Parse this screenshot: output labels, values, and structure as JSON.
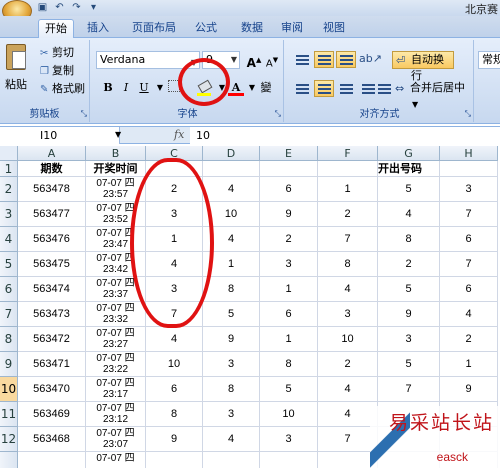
{
  "app": {
    "title": "北京赛"
  },
  "quick_access": {
    "save_icon": "save-icon",
    "undo_icon": "undo-icon",
    "redo_icon": "redo-icon"
  },
  "tabs": [
    {
      "label": "开始",
      "active": true
    },
    {
      "label": "插入"
    },
    {
      "label": "页面布局"
    },
    {
      "label": "公式"
    },
    {
      "label": "数据"
    },
    {
      "label": "审阅"
    },
    {
      "label": "视图"
    }
  ],
  "clipboard": {
    "paste_label": "粘贴",
    "cut_label": "剪切",
    "copy_label": "复制",
    "format_painter_label": "格式刷",
    "group_label": "剪贴板"
  },
  "font": {
    "font_name": "Verdana",
    "font_size": "9",
    "grow_label": "A",
    "shrink_label": "A",
    "bold_label": "B",
    "italic_label": "I",
    "underline_label": "U",
    "font_color_label": "A",
    "phonetic_label": "變",
    "group_label": "字体",
    "fill_color": "#ffff00",
    "font_color": "#ff0000"
  },
  "alignment": {
    "wrap_label": "自动换行",
    "merge_label": "合并后居中",
    "group_label": "对齐方式"
  },
  "number": {
    "format_label": "常规"
  },
  "formula_bar": {
    "name_box": "I10",
    "fx_label": "fx",
    "value": "10"
  },
  "sheet": {
    "columns": [
      "A",
      "B",
      "C",
      "D",
      "E",
      "F",
      "G",
      "H"
    ],
    "header_row": {
      "row_label": "1",
      "A": "期数",
      "B": "开奖时间",
      "draw_numbers_label": "开出号码"
    },
    "rows": [
      {
        "row_label": "2",
        "period": "563478",
        "date": "07-07 四",
        "time": "23:57",
        "values": [
          "2",
          "4",
          "6",
          "1",
          "5",
          "3"
        ]
      },
      {
        "row_label": "3",
        "period": "563477",
        "date": "07-07 四",
        "time": "23:52",
        "values": [
          "3",
          "10",
          "9",
          "2",
          "4",
          "7"
        ]
      },
      {
        "row_label": "4",
        "period": "563476",
        "date": "07-07 四",
        "time": "23:47",
        "values": [
          "1",
          "4",
          "2",
          "7",
          "8",
          "6"
        ]
      },
      {
        "row_label": "5",
        "period": "563475",
        "date": "07-07 四",
        "time": "23:42",
        "values": [
          "4",
          "1",
          "3",
          "8",
          "2",
          "7"
        ]
      },
      {
        "row_label": "6",
        "period": "563474",
        "date": "07-07 四",
        "time": "23:37",
        "values": [
          "3",
          "8",
          "1",
          "4",
          "5",
          "6"
        ]
      },
      {
        "row_label": "7",
        "period": "563473",
        "date": "07-07 四",
        "time": "23:32",
        "values": [
          "7",
          "5",
          "6",
          "3",
          "9",
          "4"
        ]
      },
      {
        "row_label": "8",
        "period": "563472",
        "date": "07-07 四",
        "time": "23:27",
        "values": [
          "4",
          "9",
          "1",
          "10",
          "3",
          "2"
        ]
      },
      {
        "row_label": "9",
        "period": "563471",
        "date": "07-07 四",
        "time": "23:22",
        "values": [
          "10",
          "3",
          "8",
          "2",
          "5",
          "1"
        ]
      },
      {
        "row_label": "10",
        "period": "563470",
        "date": "07-07 四",
        "time": "23:17",
        "values": [
          "6",
          "8",
          "5",
          "4",
          "7",
          "9"
        ],
        "selected": true
      },
      {
        "row_label": "11",
        "period": "563469",
        "date": "07-07 四",
        "time": "23:12",
        "values": [
          "8",
          "3",
          "10",
          "4",
          "",
          ""
        ]
      },
      {
        "row_label": "12",
        "period": "563468",
        "date": "07-07 四",
        "time": "23:07",
        "values": [
          "9",
          "4",
          "3",
          "7",
          "",
          ""
        ]
      },
      {
        "row_label": "",
        "period": "",
        "date": "07-07 四",
        "time": "",
        "values": [
          "",
          "",
          "",
          "",
          "",
          ""
        ]
      }
    ]
  },
  "watermark": {
    "text_cn": "易采站长站",
    "text_en": "easck"
  }
}
